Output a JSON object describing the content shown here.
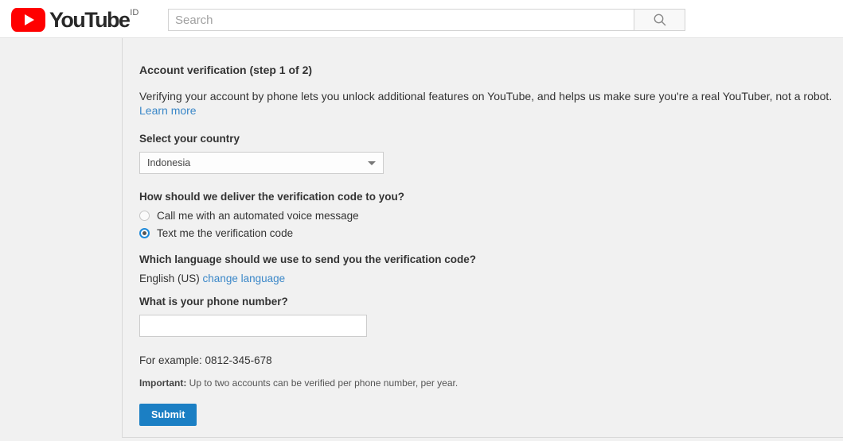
{
  "header": {
    "logo": {
      "wordmark": "YouTube",
      "country_suffix": "ID",
      "play_icon": "youtube-play-icon"
    },
    "search": {
      "placeholder": "Search",
      "value": "",
      "button_icon": "search-icon"
    }
  },
  "main": {
    "title": "Account verification (step 1 of 2)",
    "intro_text": "Verifying your account by phone lets you unlock additional features on YouTube, and helps us make sure you're a real YouTuber, not a robot.",
    "intro_link": "Learn more",
    "country": {
      "label": "Select your country",
      "selected": "Indonesia",
      "caret_icon": "chevron-down-icon"
    },
    "delivery": {
      "label": "How should we deliver the verification code to you?",
      "options": [
        {
          "label": "Call me with an automated voice message",
          "selected": false
        },
        {
          "label": "Text me the verification code",
          "selected": true
        }
      ]
    },
    "language": {
      "label": "Which language should we use to send you the verification code?",
      "current": "English (US)",
      "change_link": "change language"
    },
    "phone": {
      "label": "What is your phone number?",
      "value": "",
      "placeholder": "",
      "example": "For example: 0812-345-678"
    },
    "important": {
      "prefix": "Important:",
      "text": " Up to two accounts can be verified per phone number, per year."
    },
    "submit_label": "Submit"
  },
  "colors": {
    "brand_red": "#ff0000",
    "link_blue": "#3a87c8",
    "button_blue": "#1b7fc4",
    "radio_blue": "#1f8ada",
    "page_bg": "#f1f1f1"
  }
}
